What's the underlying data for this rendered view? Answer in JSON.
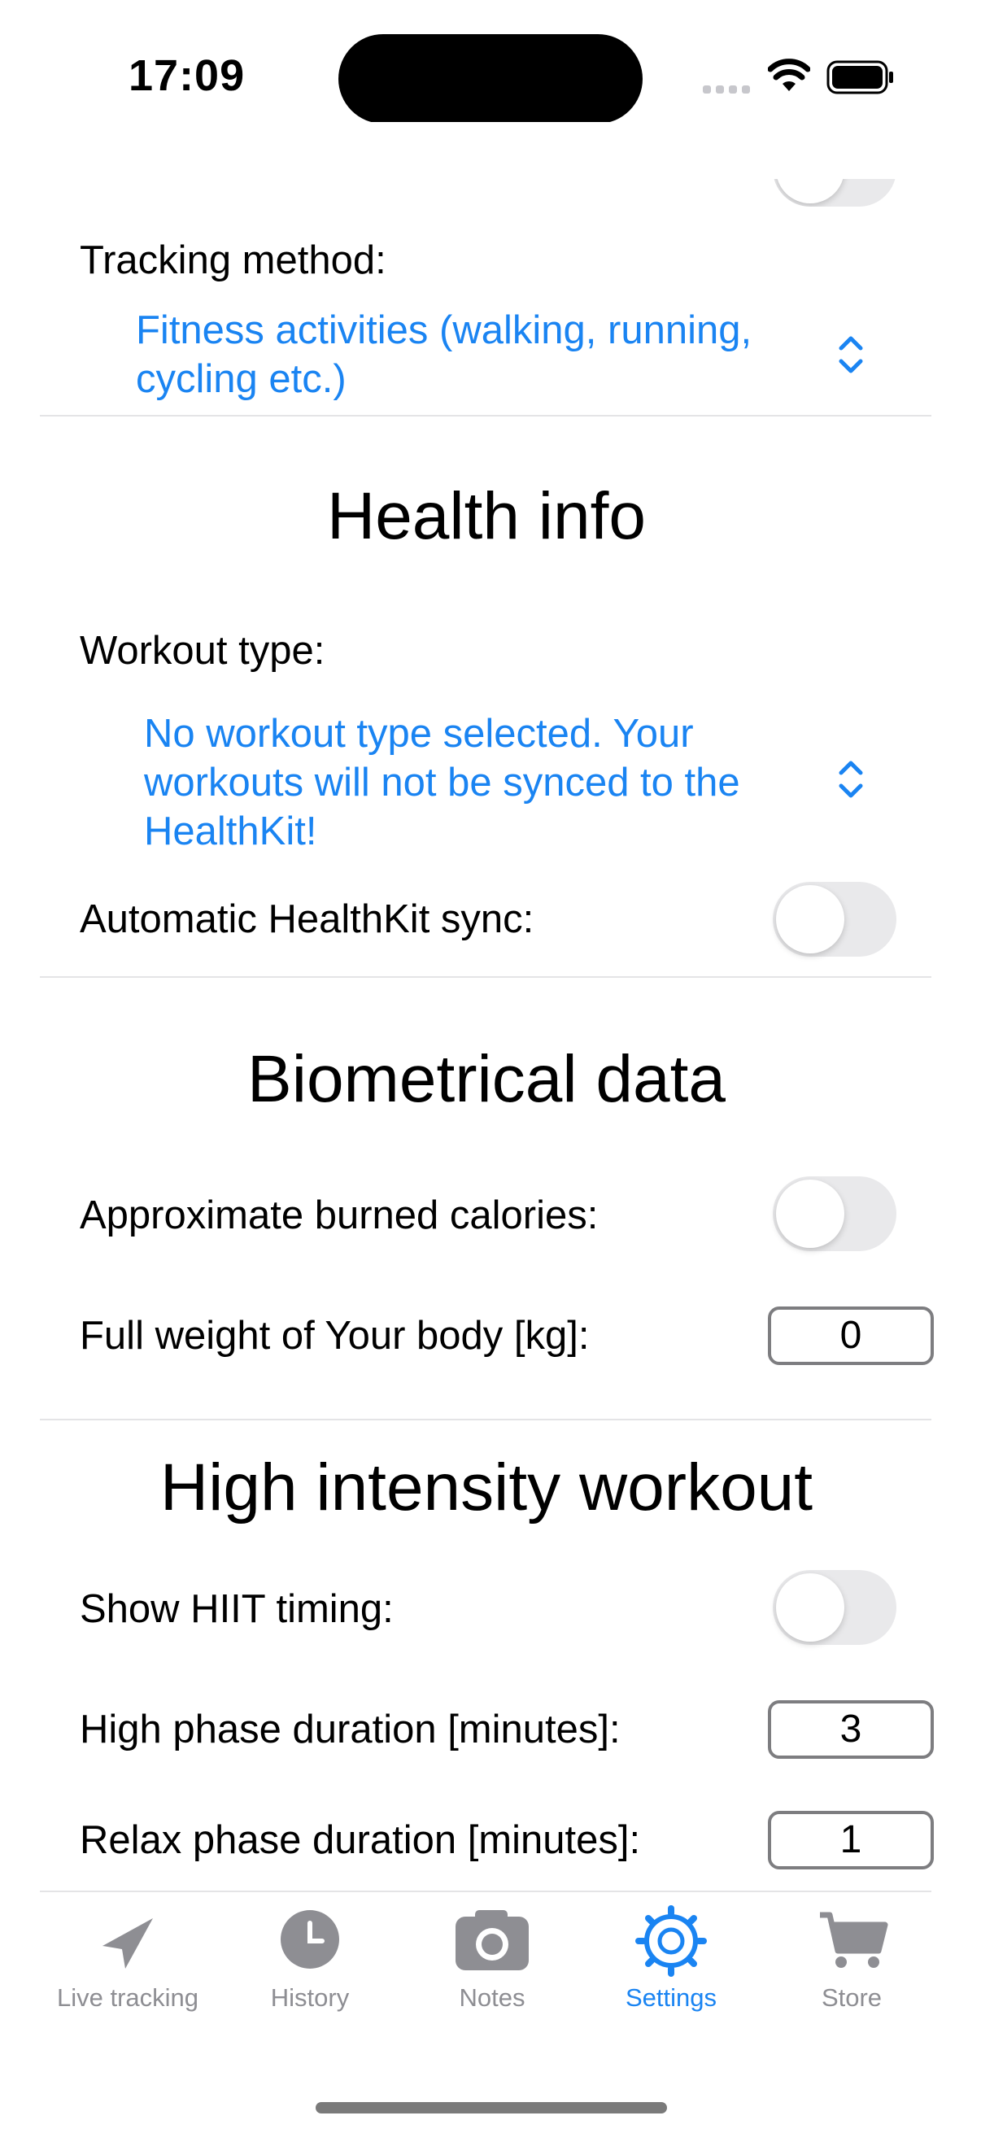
{
  "status_bar": {
    "time": "17:09"
  },
  "tracking": {
    "label": "Tracking method:",
    "value_line1": "Fitness activities (walking, running,",
    "value_line2": "cycling etc.)"
  },
  "health_info": {
    "heading": "Health info",
    "workout_label": "Workout type:",
    "workout_line1": "No workout type selected. Your",
    "workout_line2": "workouts will not be synced to the",
    "workout_line3": "HealthKit!",
    "sync_label": "Automatic HealthKit sync:",
    "sync_on": false
  },
  "biometrical": {
    "heading": "Biometrical data",
    "calories_label": "Approximate burned calories:",
    "calories_on": false,
    "weight_label": "Full weight of Your body [kg]:",
    "weight_value": "0"
  },
  "hiit": {
    "heading": "High intensity workout",
    "show_label": "Show HIIT timing:",
    "show_on": false,
    "high_label": "High phase duration [minutes]:",
    "high_value": "3",
    "relax_label": "Relax phase duration [minutes]:",
    "relax_value": "1"
  },
  "tabs": [
    {
      "label": "Live tracking",
      "icon": "location-arrow-icon",
      "active": false
    },
    {
      "label": "History",
      "icon": "clock-icon",
      "active": false
    },
    {
      "label": "Notes",
      "icon": "camera-icon",
      "active": false
    },
    {
      "label": "Settings",
      "icon": "gear-icon",
      "active": true
    },
    {
      "label": "Store",
      "icon": "cart-icon",
      "active": false
    }
  ],
  "colors": {
    "accent": "#1a84f2",
    "inactive": "#8e8e93",
    "toggle_off": "#e9e9eb"
  }
}
